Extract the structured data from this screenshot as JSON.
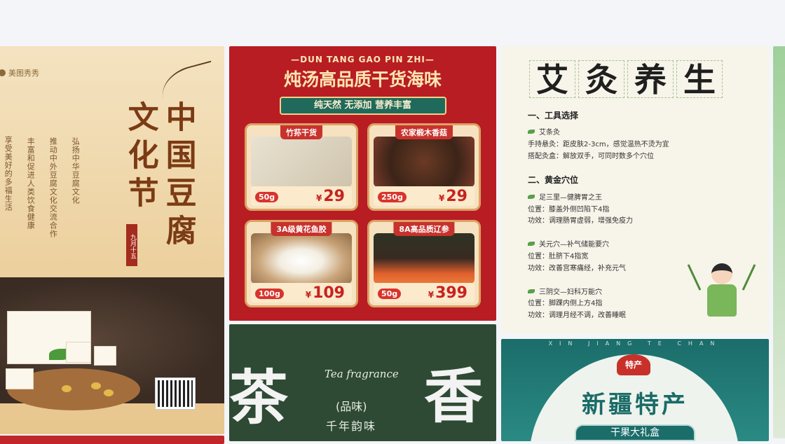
{
  "card_tofu": {
    "brand": "美图秀秀",
    "title_col1": "中国豆腐",
    "title_col2": "文化节",
    "seal": "九月十五",
    "desc": [
      "弘扬中华豆腐文化",
      "推动中外豆腐文化交流合作",
      "丰富和促进人类饮食健康",
      "享受美好的多福生活"
    ]
  },
  "card_seafood": {
    "pinyin": "—DUN TANG GAO PIN ZHI—",
    "title": "炖汤高品质干货海味",
    "ribbon": "纯天然 无添加 营养丰富",
    "products": [
      {
        "name": "竹荪干货",
        "weight": "50g",
        "currency": "¥",
        "price": "29"
      },
      {
        "name": "农家椴木香菇",
        "weight": "250g",
        "currency": "¥",
        "price": "29"
      },
      {
        "name": "3A级黄花鱼胶",
        "weight": "100g",
        "currency": "¥",
        "price": "109"
      },
      {
        "name": "8A高品质辽参",
        "weight": "50g",
        "currency": "¥",
        "price": "399"
      }
    ]
  },
  "card_moxa": {
    "title_chars": [
      "艾",
      "灸",
      "养",
      "生"
    ],
    "sec1": "一、工具选择",
    "item1": "艾条灸",
    "item1_l1": "手持悬灸：距皮肤2-3cm，感觉温热不烫为宜",
    "item1_l2": "搭配灸盒：解放双手，可同时数多个穴位",
    "sec2": "二、黄金穴位",
    "p1": "足三里—健脾胃之王",
    "p1_l1": "位置：膝盖外侧凹陷下4指",
    "p1_l2": "功效：调理肠胃虚弱，增强免疫力",
    "p2": "关元穴—补气储能要穴",
    "p2_l1": "位置：肚脐下4指宽",
    "p2_l2": "功效：改善宫寒痛经，补充元气",
    "p3": "三阴交—妇科万能穴",
    "p3_l1": "位置：脚踝内侧上方4指",
    "p3_l2": "功效：调理月经不调，改善睡眠"
  },
  "card_tea": {
    "char1": "茶",
    "char2": "香",
    "en": "Tea fragrance",
    "pinwei": "(品味)",
    "slogan": "千年韵味"
  },
  "card_xinjiang": {
    "pinyin": "XIN JIANG TE CHAN",
    "badge": "特产",
    "title": "新疆特产",
    "gift": "干果大礼盒"
  }
}
